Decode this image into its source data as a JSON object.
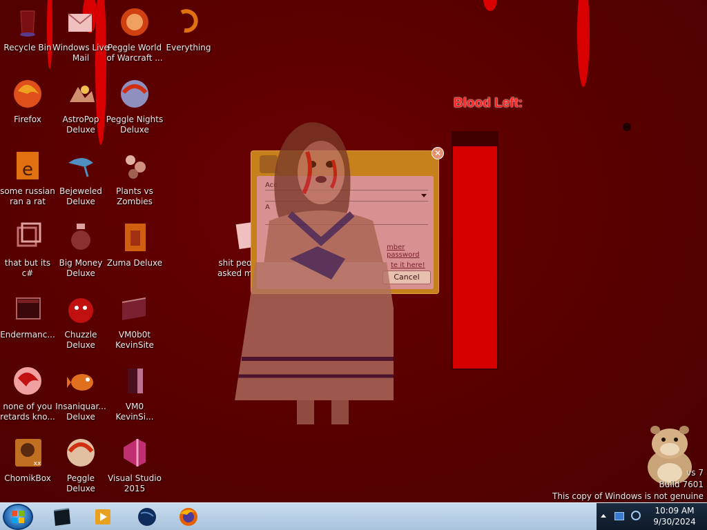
{
  "desktop": {
    "icons": [
      {
        "label": "Recycle Bin",
        "icon": "recycle-bin-icon"
      },
      {
        "label": "Windows Live Mail",
        "icon": "mail-icon"
      },
      {
        "label": "Peggle World of Warcraft ...",
        "icon": "peggle-icon"
      },
      {
        "label": "Everything",
        "icon": "search-icon"
      },
      {
        "label": "Firefox",
        "icon": "firefox-icon"
      },
      {
        "label": "AstroPop Deluxe",
        "icon": "astropop-icon"
      },
      {
        "label": "Peggle Nights Deluxe",
        "icon": "peggle-nights-icon"
      },
      {
        "label": "some russian ran a rat",
        "icon": "executable-icon"
      },
      {
        "label": "Bejeweled Deluxe",
        "icon": "bejeweled-icon"
      },
      {
        "label": "Plants vs Zombies",
        "icon": "plants-vs-zombies-icon"
      },
      {
        "label": "that but its c#",
        "icon": "program-icon"
      },
      {
        "label": "Big Money Deluxe",
        "icon": "big-money-icon"
      },
      {
        "label": "Zuma Deluxe",
        "icon": "zuma-icon"
      },
      {
        "label": "shit peo... asked m...",
        "icon": "file-icon"
      },
      {
        "label": "Endermanc...",
        "icon": "window-icon"
      },
      {
        "label": "Chuzzle Deluxe",
        "icon": "chuzzle-icon"
      },
      {
        "label": "VM0b0t KevinSite",
        "icon": "folder-icon"
      },
      {
        "label": "none of you retards kno...",
        "icon": "app-icon"
      },
      {
        "label": "Insaniquar... Deluxe",
        "icon": "insaniquarium-icon"
      },
      {
        "label": "VM0 KevinSi...",
        "icon": "document-icon"
      },
      {
        "label": "ChomikBox",
        "icon": "chomikbox-icon"
      },
      {
        "label": "Peggle Deluxe",
        "icon": "peggle-deluxe-icon"
      },
      {
        "label": "Visual Studio 2015",
        "icon": "visual-studio-icon"
      }
    ]
  },
  "dialog": {
    "field1_label": "Acc",
    "field2_label": "A",
    "remember_link": "mber password",
    "create_link": "te it here!",
    "cancel_label": "Cancel",
    "close_glyph": "✕"
  },
  "blood_meter": {
    "label": "Blood Left:",
    "level": 0.93
  },
  "watermark": {
    "line1": "vs 7",
    "line2": "Build 7601",
    "line3": "This copy of Windows is not genuine"
  },
  "taskbar": {
    "items": [
      "start-button",
      "screen-icon",
      "media-player-icon",
      "globe-icon",
      "firefox-icon"
    ],
    "clock_time": "10:09 AM",
    "clock_date": "9/30/2024"
  },
  "colors": {
    "background": "#5b0000",
    "blood": "#d80000",
    "dialog": "#c6801c",
    "taskbar": "#b6cfe6"
  }
}
